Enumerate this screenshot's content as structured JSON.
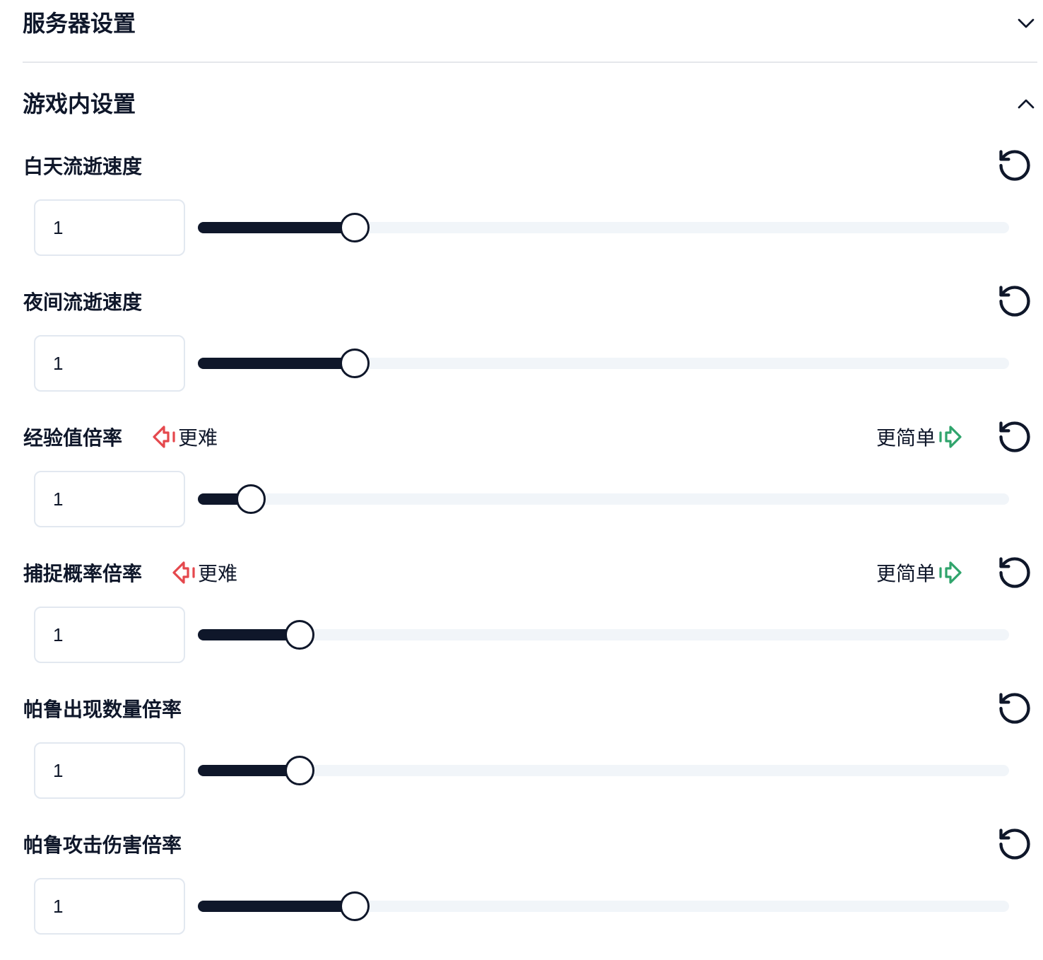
{
  "sections": [
    {
      "title": "服务器设置"
    },
    {
      "title": "游戏内设置"
    }
  ],
  "settings": [
    {
      "label": "白天流逝速度",
      "value": "1",
      "slider_fraction": 0.182
    },
    {
      "label": "夜间流逝速度",
      "value": "1",
      "slider_fraction": 0.182
    },
    {
      "label": "经验值倍率",
      "value": "1",
      "slider_fraction": 0.049,
      "harder_label": "更难",
      "easier_label": "更简单"
    },
    {
      "label": "捕捉概率倍率",
      "value": "1",
      "slider_fraction": 0.111,
      "harder_label": "更难",
      "easier_label": "更简单"
    },
    {
      "label": "帕鲁出现数量倍率",
      "value": "1",
      "slider_fraction": 0.111
    },
    {
      "label": "帕鲁攻击伤害倍率",
      "value": "1",
      "slider_fraction": 0.182
    }
  ],
  "icons": {
    "server_toggle": "chevron-down-icon",
    "game_toggle": "chevron-up-icon",
    "reset": "reset-icon",
    "harder": "arrow-big-left-dash-icon",
    "easier": "arrow-big-right-dash-icon"
  },
  "colors": {
    "text": "#0f172a",
    "slider_fill": "#0f172a",
    "slider_track": "#f1f5f9",
    "harder": "#e5484d",
    "easier": "#30a46c",
    "divider": "#e5e7eb",
    "input_border": "#e2e8f0"
  }
}
